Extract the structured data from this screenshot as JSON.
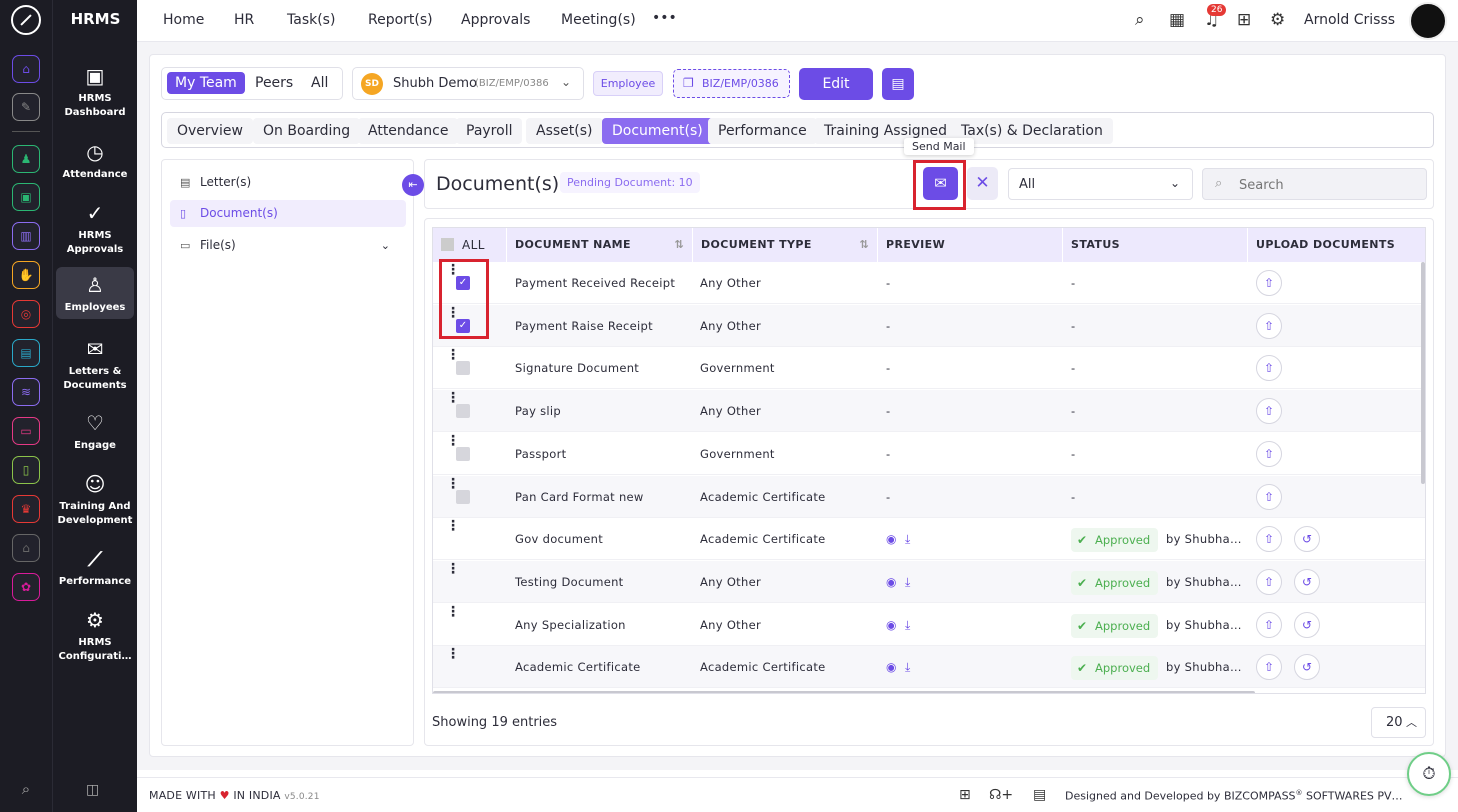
{
  "rail": {
    "colors": [
      "#6c4ce6",
      "#888888",
      "#2bb673",
      "#2bb673",
      "#8b6cf0",
      "#f5a623",
      "#e53935",
      "#2aa8c8",
      "#8b6cf0",
      "#e53985",
      "#8bc34a",
      "#e53935",
      "#666666",
      "#d81b9a"
    ],
    "icons": [
      "home-icon",
      "pin-icon",
      "people-icon",
      "box-icon",
      "briefcase-icon",
      "puzzle-icon",
      "target-icon",
      "calendar-icon",
      "chart-icon",
      "monitor-icon",
      "file-icon",
      "award-icon",
      "building-icon",
      "settings-icon"
    ]
  },
  "sidebar": {
    "brand": "HRMS",
    "modules": [
      {
        "l1": "HRMS",
        "l2": "Dashboard",
        "icon": "▣"
      },
      {
        "l1": "Attendance",
        "l2": "",
        "icon": "◷"
      },
      {
        "l1": "HRMS",
        "l2": "Approvals",
        "icon": "✓"
      },
      {
        "l1": "Employees",
        "l2": "",
        "icon": "♙"
      },
      {
        "l1": "Letters &",
        "l2": "Documents",
        "icon": "✉"
      },
      {
        "l1": "Engage",
        "l2": "",
        "icon": "♡"
      },
      {
        "l1": "Training And",
        "l2": "Development",
        "icon": "☺"
      },
      {
        "l1": "Performance",
        "l2": "",
        "icon": "⟋"
      },
      {
        "l1": "HRMS",
        "l2": "Configurati…",
        "icon": "⚙"
      }
    ]
  },
  "topnav": {
    "items": [
      "Home",
      "HR",
      "Task(s)",
      "Report(s)",
      "Approvals",
      "Meeting(s)"
    ],
    "more": "•••",
    "notification_count": "26",
    "user_name": "Arnold Crisss"
  },
  "toolbar": {
    "team_tabs": [
      "My Team",
      "Peers",
      "All"
    ],
    "employee_initials": "SD",
    "employee_name": "Shubh Demo",
    "employee_code_short": "(BIZ/EMP/0386",
    "employee_tag": "Employee",
    "employee_code": "BIZ/EMP/0386",
    "edit_label": "Edit"
  },
  "tabs": [
    "Overview",
    "On Boarding",
    "Attendance",
    "Payroll",
    "Asset(s)",
    "Document(s)",
    "Performance",
    "Training Assigned",
    "Tax(s) & Declaration"
  ],
  "tree": [
    "Letter(s)",
    "Document(s)",
    "File(s)"
  ],
  "docs": {
    "title": "Document(s)",
    "pending": "Pending Document: 10",
    "tooltip": "Send Mail",
    "filter_value": "All",
    "search_placeholder": "Search"
  },
  "table": {
    "headers": [
      "ALL",
      "DOCUMENT NAME",
      "DOCUMENT TYPE",
      "PREVIEW",
      "STATUS",
      "UPLOAD DOCUMENTS"
    ],
    "rows": [
      {
        "name": "Payment Received Receipt",
        "type": "Any Other",
        "preview": "-",
        "status": "-",
        "checked": true,
        "approved": false
      },
      {
        "name": "Payment Raise Receipt",
        "type": "Any Other",
        "preview": "-",
        "status": "-",
        "checked": true,
        "approved": false
      },
      {
        "name": "Signature Document",
        "type": "Government",
        "preview": "-",
        "status": "-",
        "checked": false,
        "approved": false
      },
      {
        "name": "Pay slip",
        "type": "Any Other",
        "preview": "-",
        "status": "-",
        "checked": false,
        "approved": false
      },
      {
        "name": "Passport",
        "type": "Government",
        "preview": "-",
        "status": "-",
        "checked": false,
        "approved": false
      },
      {
        "name": "Pan Card Format new",
        "type": "Academic Certificate",
        "preview": "-",
        "status": "-",
        "checked": false,
        "approved": false
      },
      {
        "name": "Gov document",
        "type": "Academic Certificate",
        "preview": "",
        "status": "Approved",
        "by": "by Shubha…",
        "checked": false,
        "approved": true
      },
      {
        "name": "Testing Document",
        "type": "Any Other",
        "preview": "",
        "status": "Approved",
        "by": "by Shubha…",
        "checked": false,
        "approved": true
      },
      {
        "name": "Any Specialization",
        "type": "Any Other",
        "preview": "",
        "status": "Approved",
        "by": "by Shubha…",
        "checked": false,
        "approved": true
      },
      {
        "name": "Academic Certificate",
        "type": "Academic Certificate",
        "preview": "",
        "status": "Approved",
        "by": "by Shubha…",
        "checked": false,
        "approved": true
      }
    ],
    "showing": "Showing 19 entries",
    "page_size": "20"
  },
  "footer": {
    "made_with": "MADE WITH",
    "in_india": "IN INDIA",
    "version": "v5.0.21",
    "designed_by": "Designed and Developed by",
    "company": "BIZCOMPASS",
    "reg": "®",
    "company_suffix": "SOFTWARES PV…"
  }
}
